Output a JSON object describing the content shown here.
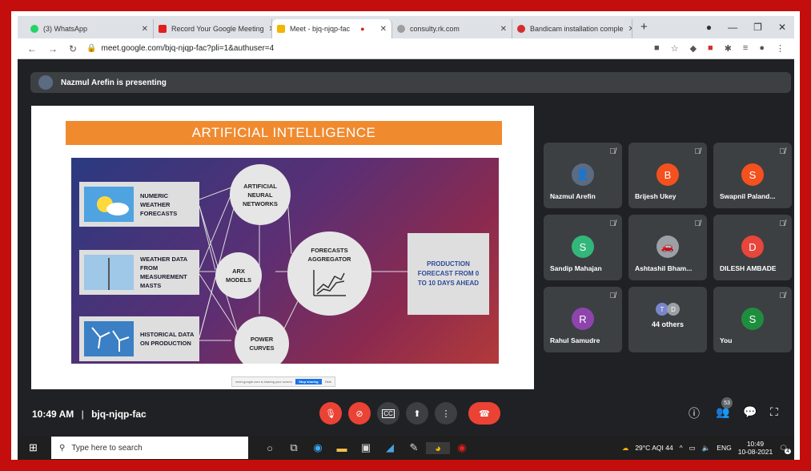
{
  "browser": {
    "tabs": [
      {
        "label": "(3) WhatsApp",
        "color": "#25d366",
        "active": false
      },
      {
        "label": "Record Your Google Meeting",
        "color": "#e02020",
        "active": false
      },
      {
        "label": "Meet - bjq-njqp-fac",
        "color": "#f4b400",
        "active": true
      },
      {
        "label": "consulty.rk.com",
        "color": "#9e9e9e",
        "active": false
      },
      {
        "label": "Bandicam installation comple",
        "color": "#d32f2f",
        "active": false
      }
    ],
    "url": "meet.google.com/bjq-njqp-fac?pli=1&authuser=4"
  },
  "presenter": {
    "text": "Nazmul Arefin is presenting"
  },
  "slide": {
    "title": "ARTIFICIAL INTELLIGENCE",
    "inputs": [
      "NUMERIC WEATHER FORECASTS",
      "WEATHER DATA FROM MEASUREMENT MASTS",
      "HISTORICAL DATA ON PRODUCTION"
    ],
    "nodes": {
      "ann": "ARTIFICIAL NEURAL NETWORKS",
      "arx": "ARX MODELS",
      "power": "POWER CURVES",
      "aggregator": "FORECASTS AGGREGATOR"
    },
    "output": "PRODUCTION FORECAST FROM 0 TO 10 DAYS AHEAD",
    "share_bar": {
      "text": "meet.google.com is sharing your screen",
      "stop": "Stop sharing",
      "hide": "Hide"
    }
  },
  "participants": [
    {
      "name": "Nazmul Arefin",
      "initial": "",
      "color": "#5b6b82"
    },
    {
      "name": "Brijesh Ukey",
      "initial": "B",
      "color": "#f4511e"
    },
    {
      "name": "Swapnil Paland...",
      "initial": "S",
      "color": "#f4511e"
    },
    {
      "name": "Sandip Mahajan",
      "initial": "S",
      "color": "#33b679"
    },
    {
      "name": "Ashtashil Bham...",
      "initial": "",
      "color": "#9aa0a6"
    },
    {
      "name": "DILESH AMBADE",
      "initial": "D",
      "color": "#e8453c"
    },
    {
      "name": "Rahul Samudre",
      "initial": "R",
      "color": "#8e44ad"
    },
    {
      "name": "44 others",
      "initial": "",
      "color": "#7986cb"
    },
    {
      "name": "You",
      "initial": "S",
      "color": "#1e8e3e"
    }
  ],
  "others_avatars": [
    "T",
    "D"
  ],
  "meeting": {
    "time": "10:49 AM",
    "code": "bjq-njqp-fac",
    "participant_count": "53"
  },
  "taskbar": {
    "search": "Type here to search",
    "weather": "29°C AQI 44",
    "lang": "ENG",
    "time": "10:49",
    "date": "10-08-2021",
    "notif": "4"
  }
}
